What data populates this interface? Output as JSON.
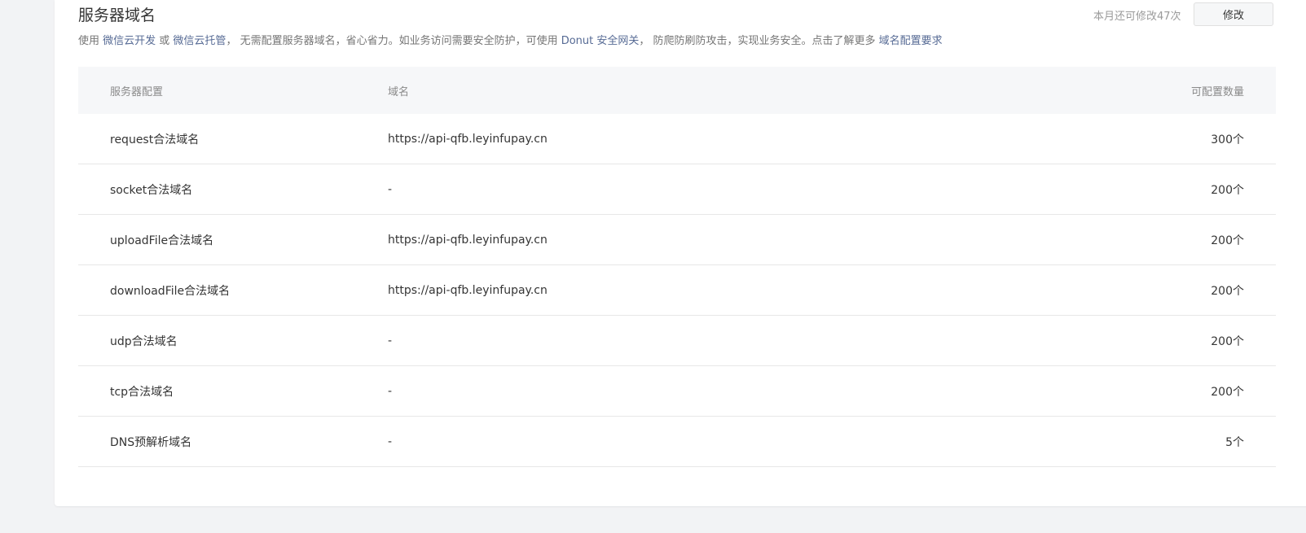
{
  "section": {
    "title": "服务器域名",
    "desc_prefix": "使用 ",
    "link_cloud_dev": "微信云开发",
    "desc_or": " 或 ",
    "link_cloud_hosting": "微信云托管",
    "desc_mid": "， 无需配置服务器域名，省心省力。如业务访问需要安全防护，可使用 ",
    "link_donut": "Donut 安全网关",
    "desc_end": "， 防爬防刷防攻击，实现业务安全。点击了解更多 ",
    "link_requirements": "域名配置要求",
    "quota_text": "本月还可修改47次",
    "modify_label": "修改"
  },
  "table": {
    "headers": {
      "config": "服务器配置",
      "domain": "域名",
      "count": "可配置数量"
    },
    "rows": [
      {
        "config": "request合法域名",
        "domain": "https://api-qfb.leyinfupay.cn",
        "count": "300个"
      },
      {
        "config": "socket合法域名",
        "domain": "-",
        "count": "200个"
      },
      {
        "config": "uploadFile合法域名",
        "domain": "https://api-qfb.leyinfupay.cn",
        "count": "200个"
      },
      {
        "config": "downloadFile合法域名",
        "domain": "https://api-qfb.leyinfupay.cn",
        "count": "200个"
      },
      {
        "config": "udp合法域名",
        "domain": "-",
        "count": "200个"
      },
      {
        "config": "tcp合法域名",
        "domain": "-",
        "count": "200个"
      },
      {
        "config": "DNS预解析域名",
        "domain": "-",
        "count": "5个"
      }
    ]
  }
}
